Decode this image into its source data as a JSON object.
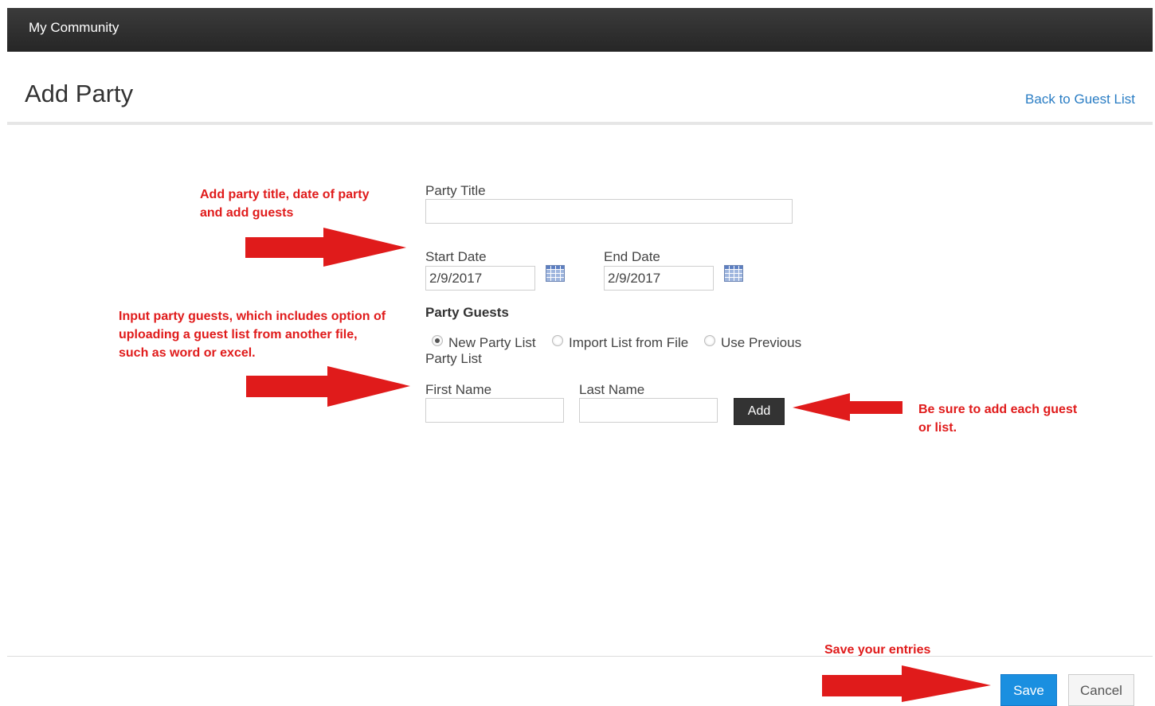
{
  "app": {
    "title": "My Community"
  },
  "header": {
    "title": "Add Party",
    "back_link": "Back to Guest List"
  },
  "form": {
    "party_title_label": "Party Title",
    "party_title_value": "",
    "start_date_label": "Start Date",
    "start_date_value": "2/9/2017",
    "end_date_label": "End Date",
    "end_date_value": "2/9/2017",
    "guests_heading": "Party Guests",
    "radio_options": [
      {
        "label": "New Party List",
        "checked": true
      },
      {
        "label": "Import List from File",
        "checked": false
      },
      {
        "label": "Use Previous",
        "checked": false
      }
    ],
    "radio_wrap_text": "Party List",
    "first_name_label": "First Name",
    "first_name_value": "",
    "last_name_label": "Last Name",
    "last_name_value": "",
    "add_label": "Add"
  },
  "annotations": {
    "note1": [
      "Add party title, date of party",
      "and add guests"
    ],
    "note2": [
      "Input party guests, which includes option of",
      "uploading a guest list from another file,",
      "such as word or excel."
    ],
    "note3": [
      "Be sure to add each guest",
      "or list."
    ],
    "note4": "Save your entries",
    "arrow_color": "#e01b1b"
  },
  "footer": {
    "save_label": "Save",
    "cancel_label": "Cancel"
  },
  "icons": {
    "calendar": "calendar-icon",
    "arrow": "red-arrow-icon"
  }
}
